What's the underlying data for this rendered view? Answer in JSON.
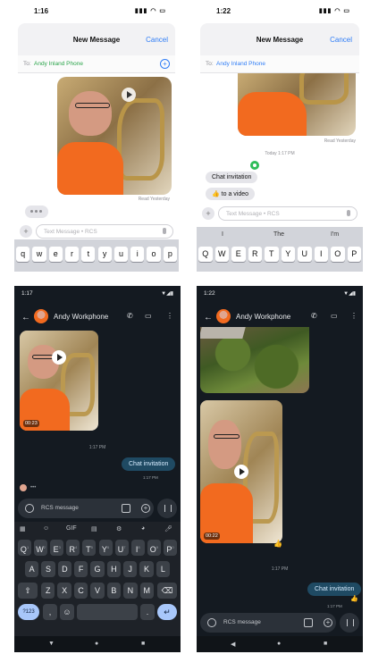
{
  "panel1": {
    "status_time": "1:16",
    "header_title": "New Message",
    "cancel_label": "Cancel",
    "to_label": "To:",
    "recipient": "Andy Inland Phone",
    "read_label": "Read Yesterday",
    "input_placeholder": "Text Message • RCS",
    "keyboard_row1": [
      "q",
      "w",
      "e",
      "r",
      "t",
      "y",
      "u",
      "i",
      "o",
      "p"
    ]
  },
  "panel2": {
    "status_time": "1:22",
    "header_title": "New Message",
    "cancel_label": "Cancel",
    "to_label": "To:",
    "recipient": "Andy Inland Phone",
    "read_label": "Read Yesterday",
    "timestamp": "Today 1:17 PM",
    "bubble1": "Chat invitation",
    "bubble2": "👍 to a video",
    "input_placeholder": "Text Message • RCS",
    "suggestions": [
      "I",
      "The",
      "I'm"
    ],
    "keyboard_row1": [
      "Q",
      "W",
      "E",
      "R",
      "T",
      "Y",
      "U",
      "I",
      "O",
      "P"
    ]
  },
  "panel3": {
    "status_time": "1:17",
    "contact_name": "Andy Workphone",
    "video_duration": "00:23",
    "timestamp": "1:17 PM",
    "bubble": "Chat invitation",
    "bubble_meta": "1:17 PM",
    "input_placeholder": "RCS message",
    "toolbar": [
      "GIF"
    ],
    "keyboard_row1": [
      "Q",
      "W",
      "E",
      "R",
      "T",
      "Y",
      "U",
      "I",
      "O",
      "P"
    ],
    "keyboard_row1_hints": [
      "1",
      "2",
      "3",
      "4",
      "5",
      "6",
      "7",
      "8",
      "9",
      "0"
    ],
    "keyboard_row2": [
      "A",
      "S",
      "D",
      "F",
      "G",
      "H",
      "J",
      "K",
      "L"
    ],
    "keyboard_row3": [
      "Z",
      "X",
      "C",
      "V",
      "B",
      "N",
      "M"
    ],
    "numbers_key": "?123",
    "comma_key": ",",
    "period_key": "."
  },
  "panel4": {
    "status_time": "1:22",
    "contact_name": "Andy Workphone",
    "video_duration": "00:22",
    "timestamp": "1:17 PM",
    "bubble": "Chat invitation",
    "bubble_meta": "1:17 PM",
    "reaction": "👍",
    "input_placeholder": "RCS message"
  },
  "colors": {
    "ios_blue": "#2f7df6",
    "ios_green": "#2aa44a",
    "android_bg": "#141a21",
    "android_bubble": "#1f4a63",
    "shirt_orange": "#f26a1f"
  }
}
